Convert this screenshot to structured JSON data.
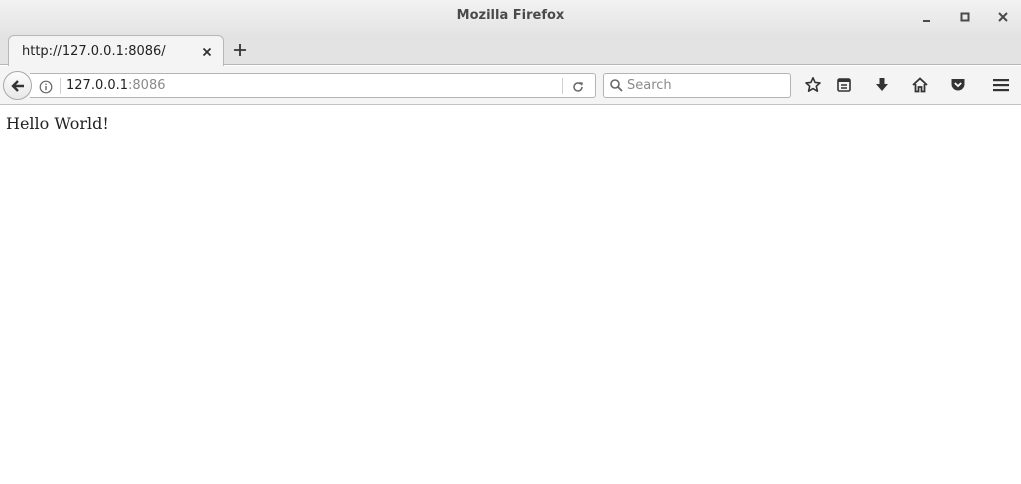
{
  "window": {
    "title": "Mozilla Firefox",
    "controls": [
      "minimize-icon",
      "maximize-icon",
      "close-icon"
    ]
  },
  "tabs": [
    {
      "title": "http://127.0.0.1:8086/",
      "active": true
    }
  ],
  "navbar": {
    "url_host": "127.0.0.1",
    "url_port": ":8086",
    "search_placeholder": "Search",
    "icons": [
      "back-icon",
      "info-icon",
      "reload-icon",
      "search-icon",
      "bookmark-star-icon",
      "reading-list-icon",
      "download-icon",
      "home-icon",
      "pocket-icon",
      "menu-icon"
    ]
  },
  "page": {
    "text": "Hello World!"
  }
}
